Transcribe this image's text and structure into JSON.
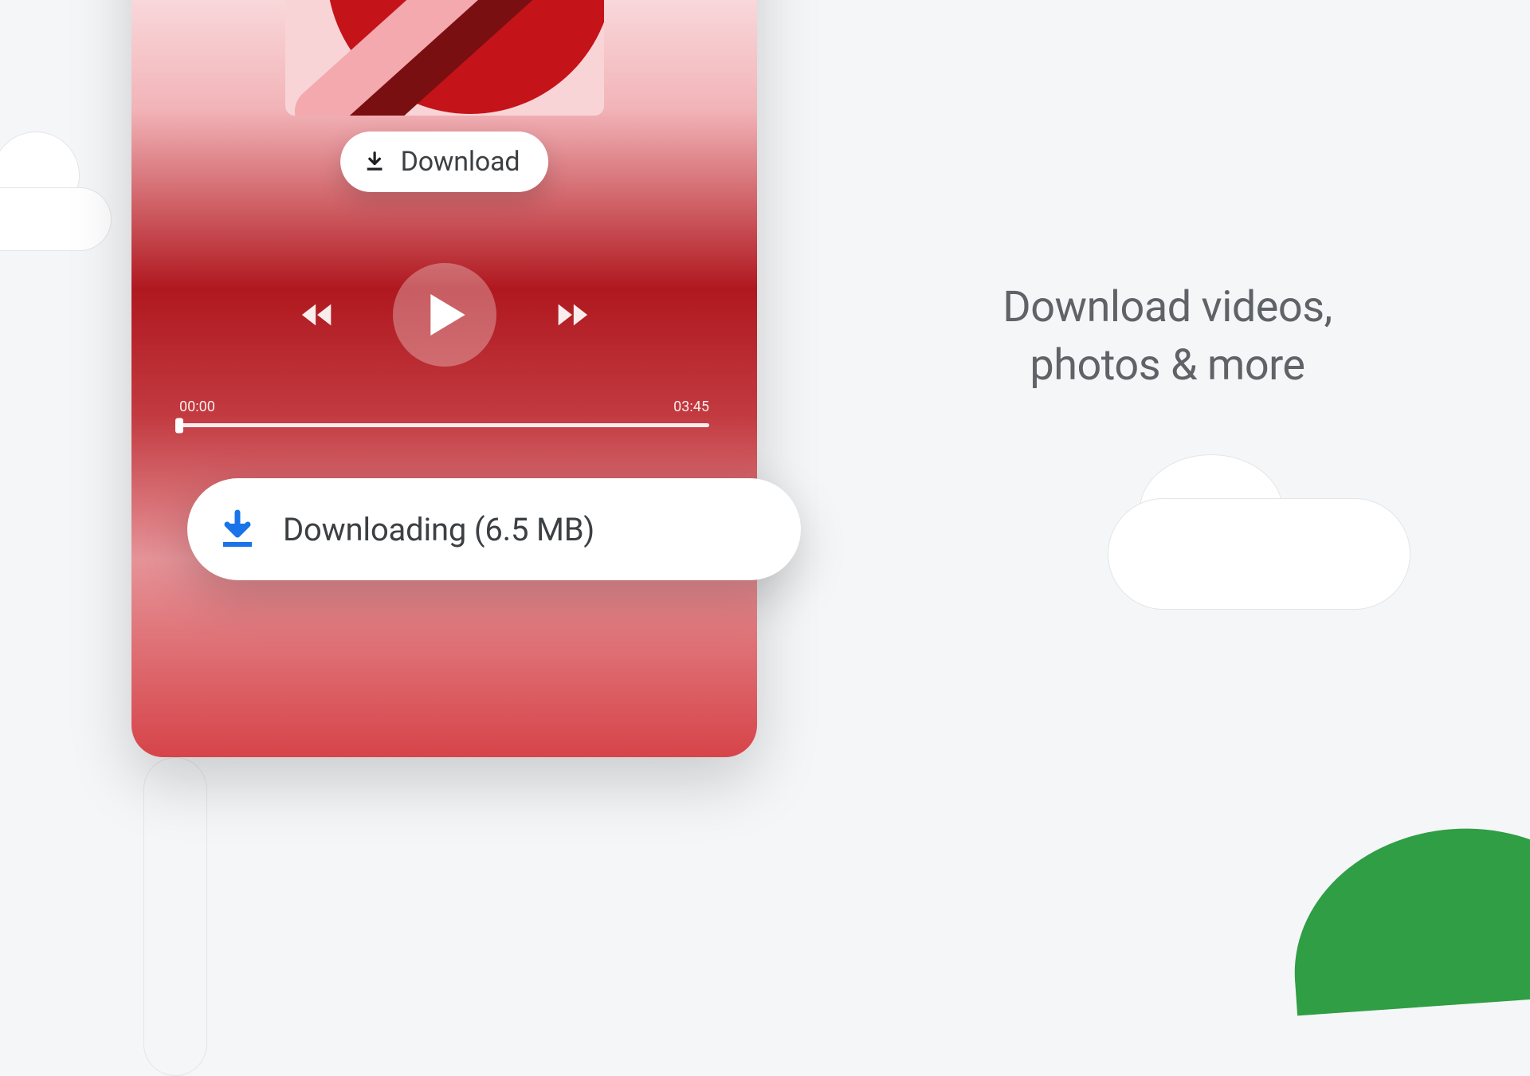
{
  "headline": {
    "line1": "Download videos,",
    "line2": "photos & more"
  },
  "phone": {
    "download_button_label": "Download",
    "timeline": {
      "current": "00:00",
      "total": "03:45"
    },
    "downloading_label": "Downloading (6.5 MB)"
  },
  "colors": {
    "accent_blue": "#1a73e8",
    "text_gray": "#3c4043",
    "headline_gray": "#5f6368",
    "red_primary": "#c5131a",
    "green_hill": "#2f9e44"
  }
}
